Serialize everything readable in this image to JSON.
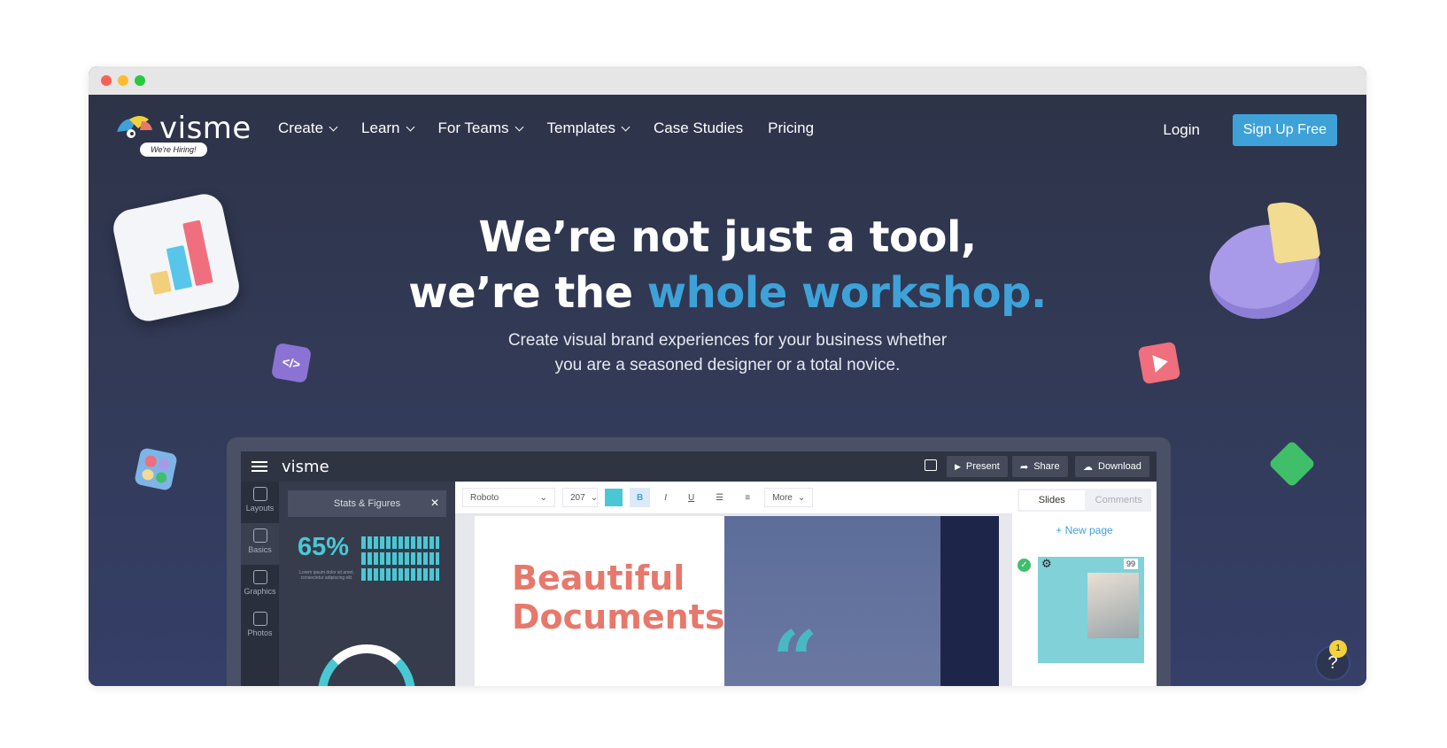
{
  "window": {
    "controls": {
      "close_color": "#ff5f57",
      "minimize_color": "#febc2e",
      "maximize_color": "#28c840"
    }
  },
  "nav": {
    "logo_text": "visme",
    "hiring_badge": "We're Hiring!",
    "menu": [
      {
        "label": "Create",
        "has_dropdown": true
      },
      {
        "label": "Learn",
        "has_dropdown": true
      },
      {
        "label": "For Teams",
        "has_dropdown": true
      },
      {
        "label": "Templates",
        "has_dropdown": true
      },
      {
        "label": "Case Studies",
        "has_dropdown": false
      },
      {
        "label": "Pricing",
        "has_dropdown": false
      }
    ],
    "login_label": "Login",
    "signup_label": "Sign Up Free"
  },
  "hero": {
    "title_line1": "We’re not just a tool,",
    "title_line2_prefix": "we’re the ",
    "title_line2_accent": "whole workshop.",
    "subtitle_line1": "Create visual brand experiences for your business whether",
    "subtitle_line2": "you are a seasoned designer or a total novice.",
    "accent_color": "#3ea2d8"
  },
  "mockup": {
    "logo_text": "visme",
    "top_buttons": {
      "present": "Present",
      "share": "Share",
      "download": "Download"
    },
    "tools": [
      {
        "label": "Layouts",
        "icon": "layouts-icon"
      },
      {
        "label": "Basics",
        "icon": "basics-icon"
      },
      {
        "label": "Graphics",
        "icon": "graphics-icon"
      },
      {
        "label": "Photos",
        "icon": "photos-icon"
      }
    ],
    "panel_title": "Stats & Figures",
    "panel_stat": "65%",
    "panel_caption": "Lorem ipsum dolor sit amet, consectetur adipiscing elit.",
    "editor": {
      "font": "Roboto",
      "size": "207",
      "bold": "B",
      "italic": "I",
      "underline": "U",
      "more": "More"
    },
    "doc_title_line1": "Beautiful",
    "doc_title_line2": "Documents",
    "right_tabs": {
      "slides": "Slides",
      "comments": "Comments"
    },
    "new_page": "+ New page",
    "page_number": "99"
  },
  "help": {
    "label": "?",
    "badge": "1"
  }
}
